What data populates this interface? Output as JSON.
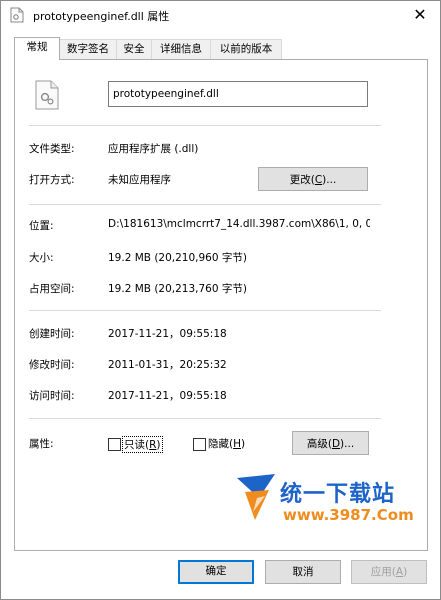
{
  "window": {
    "title": "prototypeenginef.dll 属性",
    "close_glyph": "✕"
  },
  "tabs": [
    {
      "label": "常规"
    },
    {
      "label": "数字签名"
    },
    {
      "label": "安全"
    },
    {
      "label": "详细信息"
    },
    {
      "label": "以前的版本"
    }
  ],
  "general": {
    "file_name": "prototypeenginef.dll",
    "file_type_label": "文件类型:",
    "file_type_value": "应用程序扩展 (.dll)",
    "open_with_label": "打开方式:",
    "open_with_value": "未知应用程序",
    "change_button_prefix": "更改(",
    "change_button_key": "C",
    "change_button_suffix": ")...",
    "location_label": "位置:",
    "location_value": "D:\\181613\\mclmcrrt7_14.dll.3987.com\\X86\\1, 0, 0,",
    "size_label": "大小:",
    "size_value": "19.2 MB (20,210,960 字节)",
    "size_on_disk_label": "占用空间:",
    "size_on_disk_value": "19.2 MB (20,213,760 字节)",
    "created_label": "创建时间:",
    "created_value": "2017-11-21，09:55:18",
    "modified_label": "修改时间:",
    "modified_value": "2011-01-31，20:25:32",
    "accessed_label": "访问时间:",
    "accessed_value": "2017-11-21，09:55:18",
    "attributes_label": "属性:",
    "readonly_prefix": "只读(",
    "readonly_key": "R",
    "readonly_suffix": ")",
    "hidden_prefix": "隐藏(",
    "hidden_key": "H",
    "hidden_suffix": ")",
    "advanced_prefix": "高级(",
    "advanced_key": "D",
    "advanced_suffix": ")..."
  },
  "watermark": {
    "brand_text": "统一下载站",
    "url_text": "www.3987.Com"
  },
  "footer": {
    "ok_label": "确定",
    "cancel_label": "取消",
    "apply_prefix": "应用(",
    "apply_key": "A",
    "apply_suffix": ")"
  },
  "colors": {
    "accent": "#0078d7",
    "watermark_blue": "#1e64c8",
    "watermark_orange": "#f08c1e"
  }
}
